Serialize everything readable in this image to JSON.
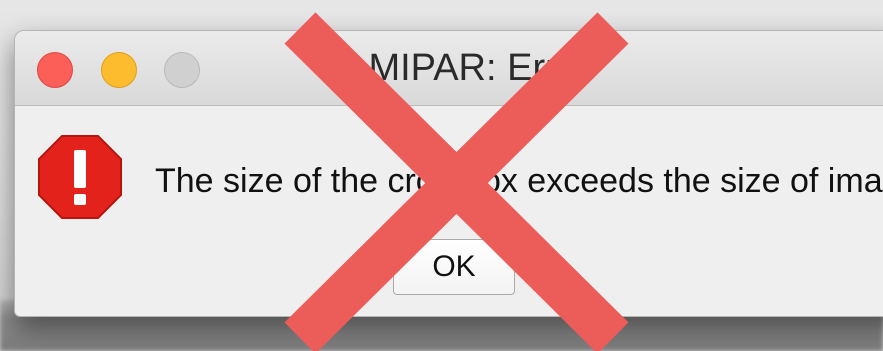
{
  "window": {
    "title": "MIPAR: Error"
  },
  "dialog": {
    "message": "The size of the crop box exceeds the size of image.",
    "ok_label": "OK"
  },
  "icons": {
    "traffic_close": "close-icon",
    "traffic_minimize": "minimize-icon",
    "traffic_zoom": "zoom-icon",
    "error": "error-stop-icon",
    "overlay": "red-x-overlay-icon"
  },
  "colors": {
    "close": "#fc5f57",
    "minimize": "#fdbc2e",
    "zoom": "#d0d0d0",
    "error_red": "#e3221c",
    "overlay_red": "#ec5d5a"
  }
}
